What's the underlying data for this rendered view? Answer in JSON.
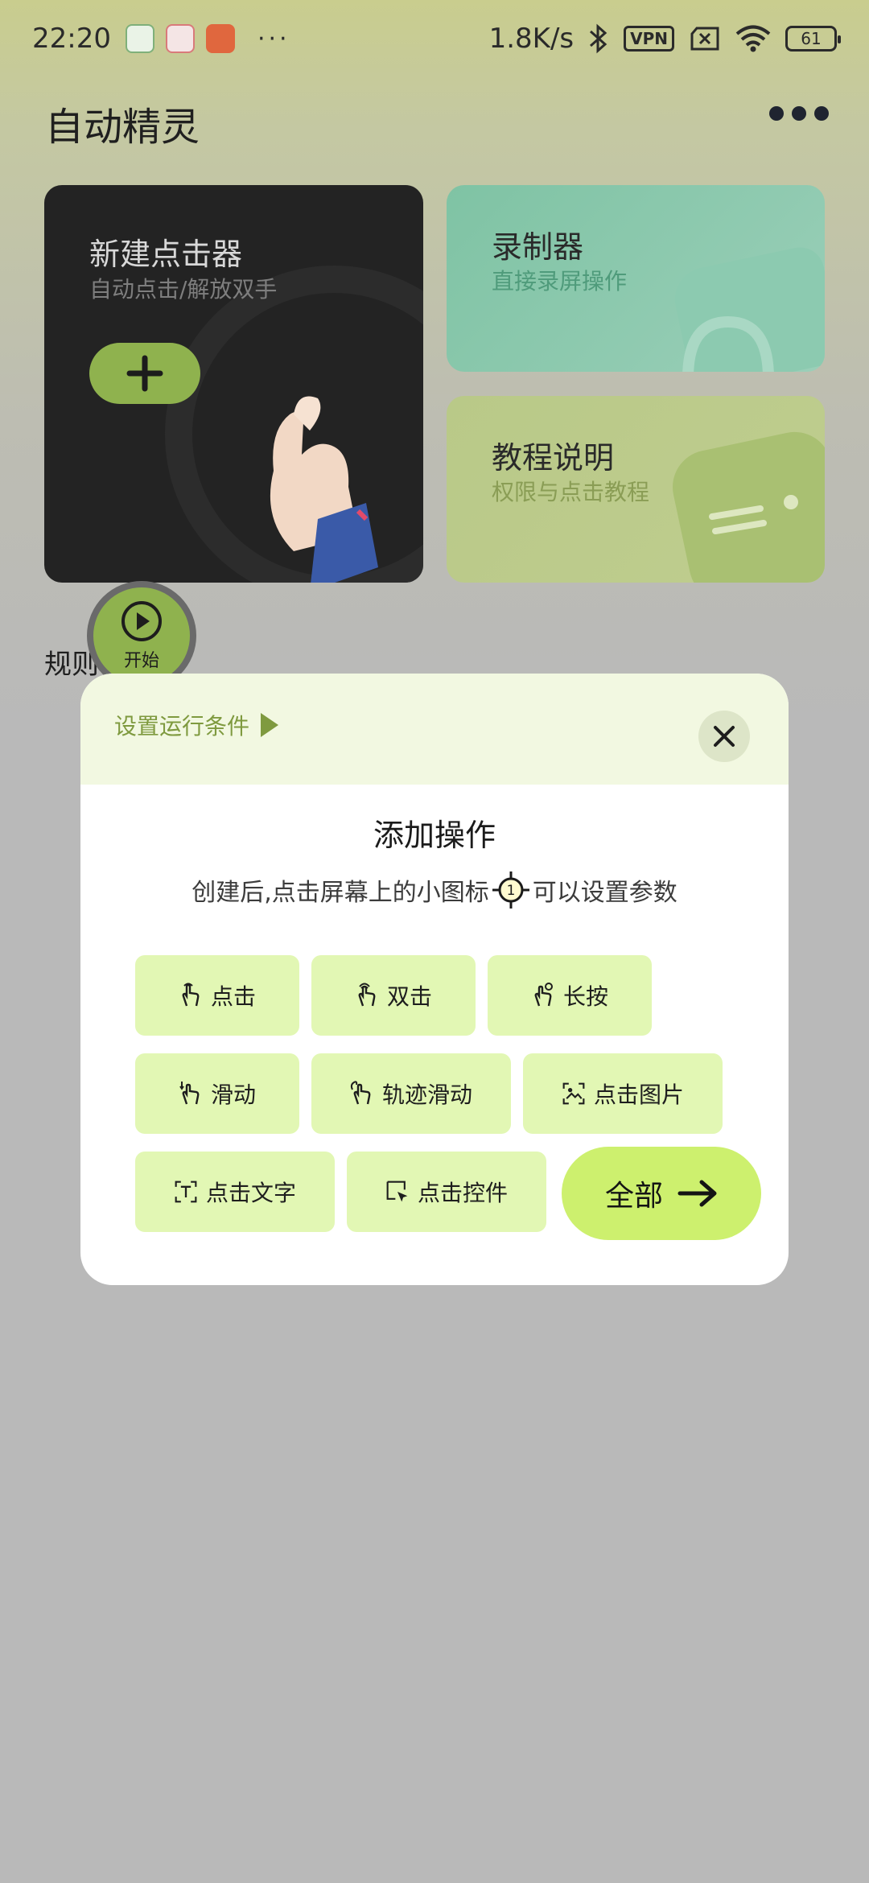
{
  "status_bar": {
    "time": "22:20",
    "network_speed": "1.8K/s",
    "vpn": "VPN",
    "battery": "61",
    "more": "···"
  },
  "header": {
    "title": "自动精灵",
    "more_icon": "more-dots-icon"
  },
  "cards": {
    "new_clicker": {
      "title": "新建点击器",
      "subtitle": "自动点击/解放双手"
    },
    "recorder": {
      "title": "录制器",
      "subtitle": "直接录屏操作"
    },
    "tutorial": {
      "title": "教程说明",
      "subtitle": "权限与点击教程"
    }
  },
  "rules_label": "规则",
  "floating_start": {
    "label": "开始"
  },
  "dialog": {
    "run_condition": "设置运行条件",
    "title": "添加操作",
    "hint_before": "创建后,点击屏幕上的小图标",
    "hint_icon_number": "1",
    "hint_after": "可以设置参数",
    "operations": [
      {
        "label": "点击",
        "icon": "tap-icon"
      },
      {
        "label": "双击",
        "icon": "double-tap-icon"
      },
      {
        "label": "长按",
        "icon": "long-press-icon"
      },
      {
        "label": "滑动",
        "icon": "swipe-icon"
      },
      {
        "label": "轨迹滑动",
        "icon": "path-swipe-icon"
      },
      {
        "label": "点击图片",
        "icon": "image-click-icon"
      },
      {
        "label": "点击文字",
        "icon": "text-click-icon"
      },
      {
        "label": "点击控件",
        "icon": "widget-click-icon"
      }
    ],
    "all_button": "全部"
  },
  "colors": {
    "accent_green": "#8fb24e",
    "op_button_bg": "#e2f7b4",
    "all_button_bg": "#cdf06e",
    "dialog_header_bg": "#f2f8e1"
  }
}
